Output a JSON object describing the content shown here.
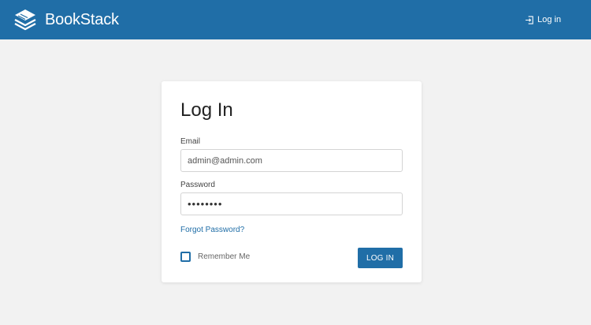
{
  "app": {
    "name": "BookStack",
    "brand_color": "#206ea7",
    "logo_icon": "books-stack-icon"
  },
  "header": {
    "login_label": "Log in",
    "login_icon": "login-arrow-icon"
  },
  "form": {
    "title": "Log In",
    "email_label": "Email",
    "email_value": "admin@admin.com",
    "password_label": "Password",
    "password_value": "••••••••",
    "forgot_label": "Forgot Password?",
    "remember_label": "Remember Me",
    "remember_checked": false,
    "submit_label": "LOG IN"
  }
}
